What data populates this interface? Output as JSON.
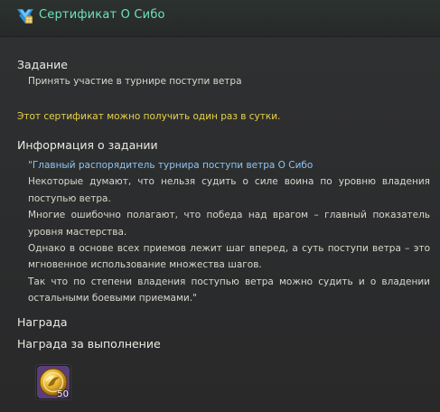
{
  "window": {
    "title": "Сертификат О Сибо",
    "icon": "certificate-icon"
  },
  "task": {
    "heading": "Задание",
    "description": "Принять участие в турнире поступи ветра",
    "notice": "Этот сертификат можно получить один раз в сутки.",
    "notice_color": "#e8d24a"
  },
  "info": {
    "heading": "Информация о задании",
    "speaker": "\"Главный распорядитель турнира поступи ветра О Сибо",
    "paragraphs": [
      "Некоторые думают, что нельзя судить о силе воина по уровню владения поступью ветра.",
      "Многие ошибочно полагают, что победа над врагом – главный показатель уровня мастерства.",
      "Однако в основе всех приемов лежит шаг вперед, а суть поступи ветра – это мгновенное использование множества шагов.",
      "Так что по степени владения поступью ветра можно судить и о владении остальными боевыми приемами.\""
    ]
  },
  "reward": {
    "heading": "Награда",
    "subheading": "Награда за выполнение",
    "item_icon": "gold-coin-icon",
    "item_count": "50"
  },
  "colors": {
    "title": "#6ee3b8",
    "speaker": "#8fc5f2",
    "text": "#d9d7cf",
    "background": "#2b2c2d"
  }
}
